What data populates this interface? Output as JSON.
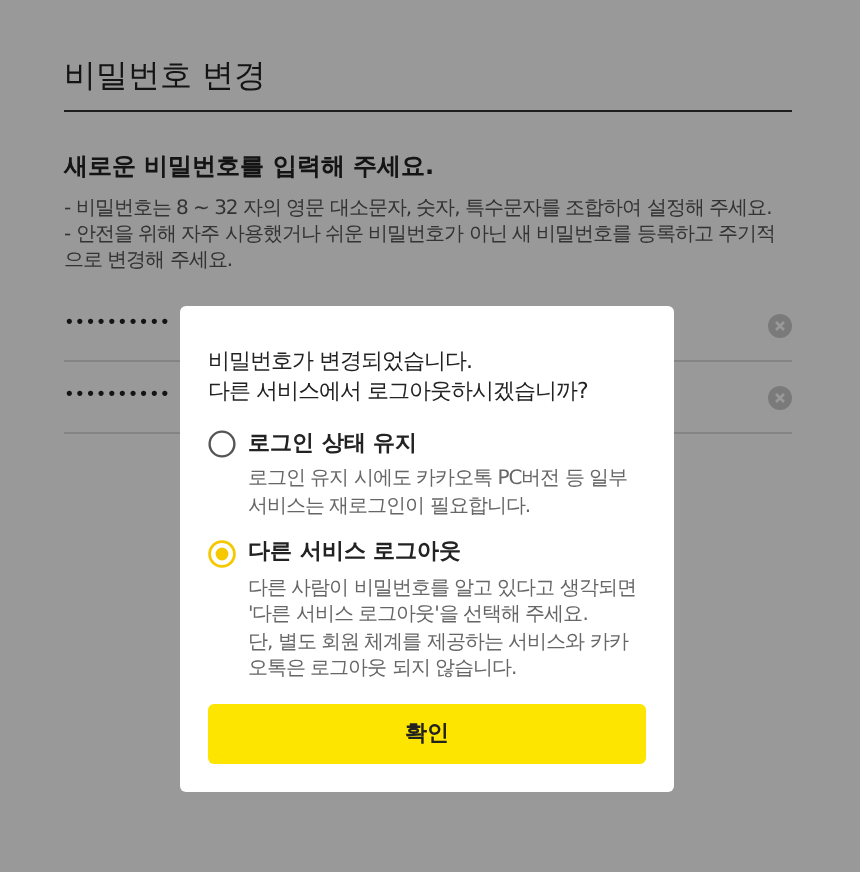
{
  "page": {
    "title": "비밀번호 변경",
    "heading": "새로운 비밀번호를 입력해 주세요.",
    "notes": [
      "- 비밀번호는 8 ~ 32 자의 영문 대소문자, 숫자, 특수문자를 조합하여 설정해 주세요.",
      "- 안전을 위해 자주 사용했거나 쉬운 비밀번호가 아닌 새 비밀번호를 등록하고 주기적으로 변경해 주세요."
    ],
    "fields": [
      {
        "value": "••••••••••"
      },
      {
        "value": "••••••••••"
      }
    ]
  },
  "dialog": {
    "title": [
      "비밀번호가 변경되었습니다.",
      "다른 서비스에서 로그아웃하시겠습니까?"
    ],
    "options": [
      {
        "label": "로그인 상태 유지",
        "selected": false,
        "description": [
          "로그인 유지 시에도 카카오톡 PC버전 등 일부 서비스는 재로그인이 필요합니다."
        ]
      },
      {
        "label": "다른 서비스 로그아웃",
        "selected": true,
        "description": [
          "다른 사람이 비밀번호를 알고 있다고 생각되면 '다른 서비스 로그아웃'을 선택해 주세요.",
          "단, 별도 회원 체계를 제공하는 서비스와 카카오톡은 로그아웃 되지 않습니다."
        ]
      }
    ],
    "confirm": "확인"
  }
}
